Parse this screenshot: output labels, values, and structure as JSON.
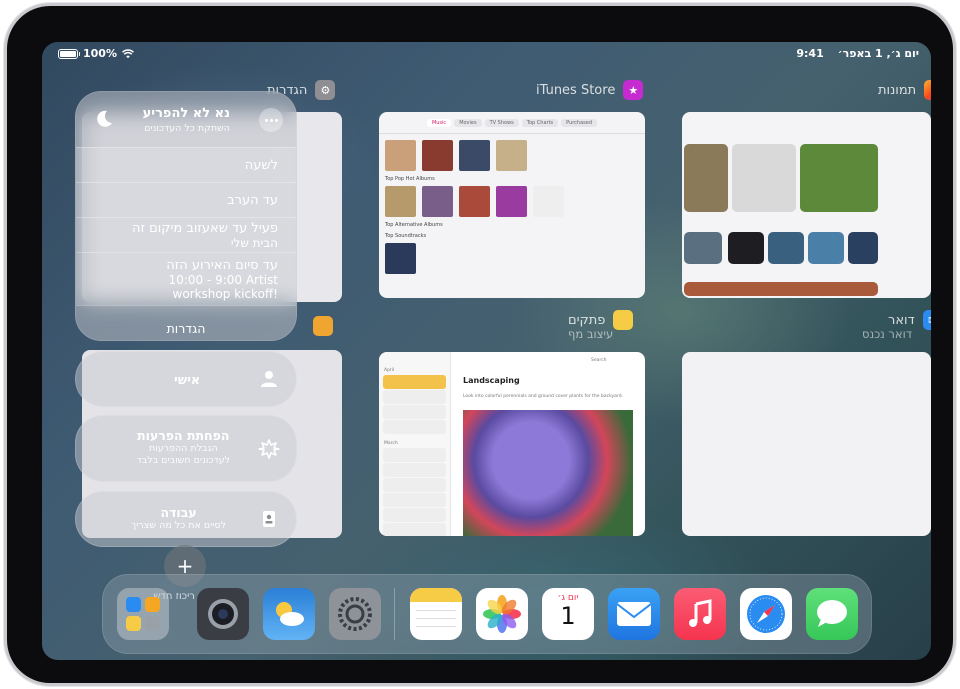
{
  "status_bar": {
    "battery": "100%",
    "time": "9:41",
    "date": "יום ג׳, 1 באפר׳"
  },
  "apps": {
    "itunes": {
      "title": "iTunes Store",
      "tabs": [
        "Music",
        "Movies",
        "TV Shows",
        "Top Charts",
        "Purchased"
      ],
      "sections": [
        "Top Pop Hot Albums",
        "Top Alternative Albums",
        "Top Soundtracks"
      ]
    },
    "photos": {
      "title": "תמונות"
    },
    "settings": {
      "title": "הגדרות"
    },
    "notes": {
      "title": "פתקים",
      "subtitle": "עיצוב מף",
      "note_title": "Landscaping",
      "note_body": "Look into colorful perennials and ground cover plants for the backyard.",
      "month_april": "April",
      "month_march": "March",
      "search": "Search"
    },
    "mail": {
      "title": "דואר",
      "subtitle": "דואר נכנס"
    }
  },
  "focus": {
    "title": "נא לא להפריע",
    "subtitle": "השתקת כל העדכונים",
    "options": [
      {
        "label": "לשעה"
      },
      {
        "label": "עד הערב"
      },
      {
        "label": "פעיל עד שאעזוב מיקום זה",
        "detail": "הבית שלי"
      },
      {
        "label": "עד סיום האירוע הזה",
        "detail": "10:00 - 9:00 Artist",
        "detail2": "workshop kickoff!"
      }
    ],
    "settings_label": "הגדרות",
    "modes": [
      {
        "title": "אישי"
      },
      {
        "title": "הפחתת הפרעות",
        "line1": "הגבלת ההפרעות",
        "line2": "לעדכונים חשובים בלבד"
      },
      {
        "title": "עבודה",
        "line1": "לסיים את כל מה שצריך"
      }
    ],
    "add_label": "מצב ריכוז חדש"
  },
  "dock": {
    "calendar_day": "יום ג׳",
    "calendar_date": "1",
    "apps": [
      "App Library",
      "Camera",
      "Weather",
      "Settings",
      "Notes",
      "Photos",
      "Calendar",
      "Mail",
      "Music",
      "Safari",
      "Messages"
    ]
  },
  "colors": {
    "notes_yellow": "#f2c24b",
    "itunes_pink": "#d21c6b",
    "music_red": "#f5344f",
    "messages_green": "#36c759",
    "mail_blue": "#2a8cf0"
  }
}
